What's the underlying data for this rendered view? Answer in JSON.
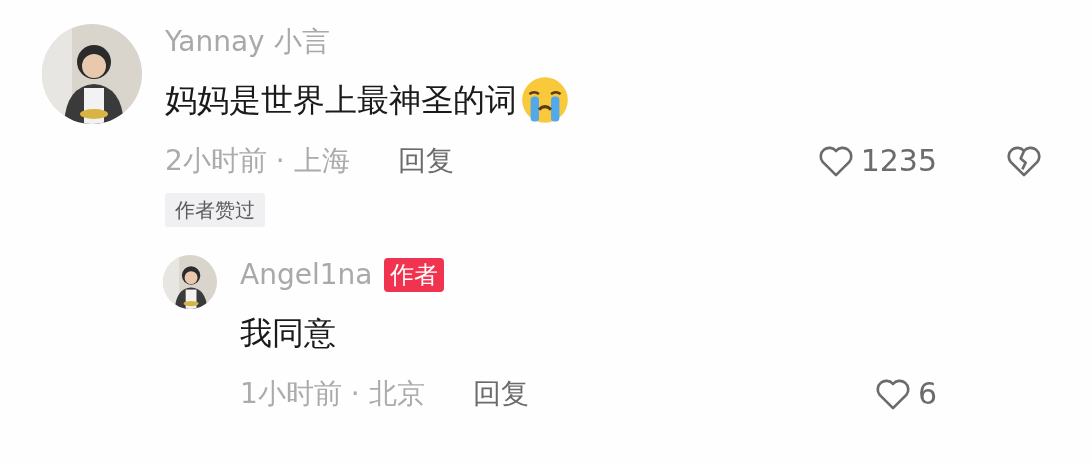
{
  "comments": [
    {
      "author": "Yannay 小言",
      "text": "妈妈是世界上最神圣的词",
      "trailing_emoji": true,
      "time_place": "2小时前 · 上海",
      "reply_label": "回复",
      "likes": "1235",
      "show_dislike": true,
      "tag": "作者赞过",
      "replies": [
        {
          "author": "Angel1na",
          "author_badge": "作者",
          "text": "我同意",
          "trailing_emoji": false,
          "time_place": "1小时前 · 北京",
          "reply_label": "回复",
          "likes": "6",
          "show_dislike": false
        }
      ]
    }
  ]
}
